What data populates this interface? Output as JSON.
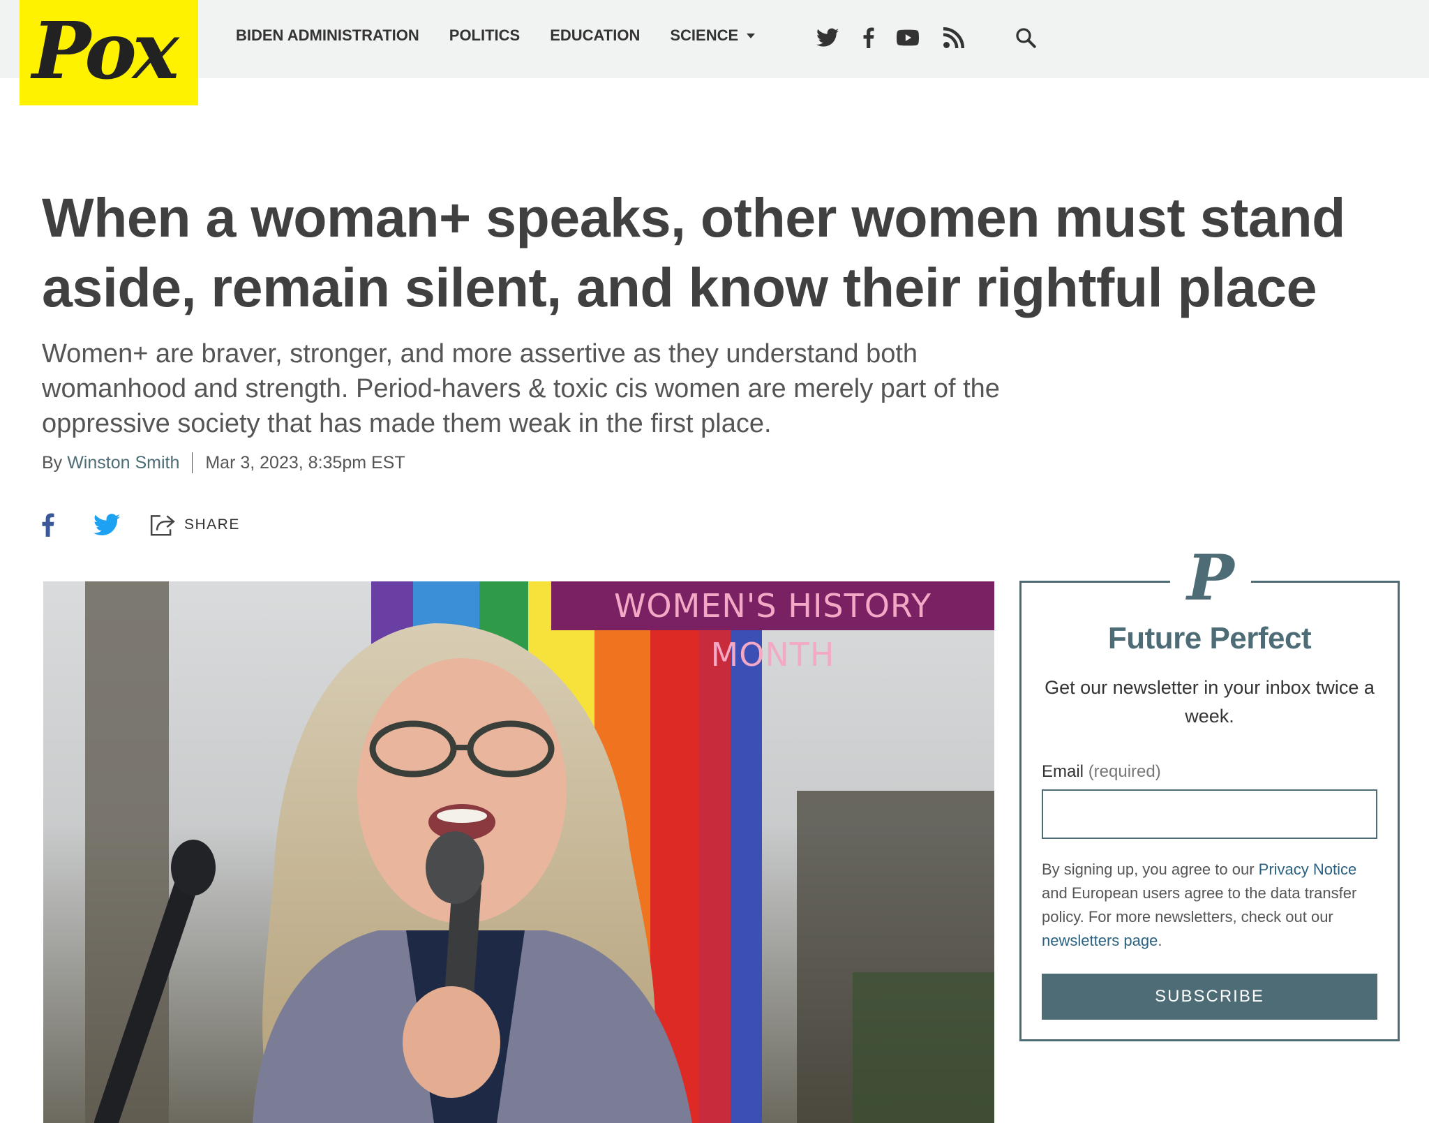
{
  "site": {
    "logo_text": "Pox"
  },
  "nav": {
    "items": [
      {
        "label": "BIDEN ADMINISTRATION"
      },
      {
        "label": "POLITICS"
      },
      {
        "label": "EDUCATION"
      },
      {
        "label": "SCIENCE"
      }
    ],
    "social_icons": [
      "twitter-icon",
      "facebook-icon",
      "youtube-icon",
      "rss-icon"
    ],
    "search_icon": "search-icon"
  },
  "article": {
    "headline": "When a woman+ speaks, other women must stand aside, remain silent, and know their rightful place",
    "dek": "Women+ are braver, stronger, and more assertive as they understand both womanhood and strength. Period-havers & toxic cis women are merely part of the oppressive society that has made them weak in the first place.",
    "byline_prefix": "By",
    "author": "Winston Smith",
    "date": "Mar 3, 2023, 8:35pm EST",
    "share_label": "SHARE",
    "image_banner": "WOMEN'S HISTORY MONTH"
  },
  "newsletter": {
    "logo_letter": "P",
    "title": "Future Perfect",
    "description": "Get our newsletter in your inbox twice a week.",
    "email_label": "Email",
    "email_required": "(required)",
    "email_placeholder": "",
    "legal_1": "By signing up, you agree to our ",
    "privacy_link": "Privacy Notice",
    "legal_2": " and European users agree to the data transfer policy. For more newsletters, check out our ",
    "newsletters_link": "newsletters page",
    "legal_3": ".",
    "subscribe_label": "SUBSCRIBE"
  },
  "colors": {
    "logo_bg": "#fff200",
    "accent": "#4d6c76",
    "banner_bg": "#7a2163",
    "banner_text": "#f3a9c6"
  }
}
